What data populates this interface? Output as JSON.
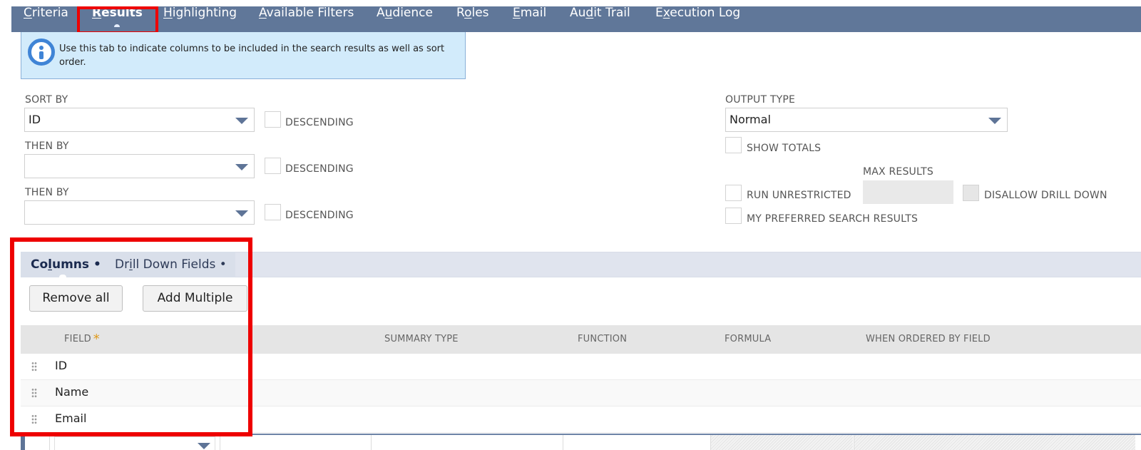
{
  "tabs": [
    {
      "pre": "",
      "u": "C",
      "post": "riteria",
      "active": false
    },
    {
      "pre": "",
      "u": "R",
      "post": "esults",
      "active": true
    },
    {
      "pre": "",
      "u": "H",
      "post": "ighlighting",
      "active": false
    },
    {
      "pre": "",
      "u": "A",
      "post": "vailable Filters",
      "active": false
    },
    {
      "pre": "A",
      "u": "u",
      "post": "dience",
      "active": false
    },
    {
      "pre": "R",
      "u": "o",
      "post": "les",
      "active": false
    },
    {
      "pre": "",
      "u": "E",
      "post": "mail",
      "active": false
    },
    {
      "pre": "Au",
      "u": "d",
      "post": "it Trail",
      "active": false
    },
    {
      "pre": "E",
      "u": "x",
      "post": "ecution Log",
      "active": false
    }
  ],
  "info": {
    "icon": "info-icon",
    "text": "Use this tab to indicate columns to be included in the search results as well as sort order."
  },
  "sorting": {
    "sort_by_label": "SORT BY",
    "sort_by_value": "ID",
    "then_by_label": "THEN BY",
    "then_by_1_value": "",
    "then_by_2_value": "",
    "descending_label": "DESCENDING"
  },
  "output": {
    "output_type_label": "OUTPUT TYPE",
    "output_type_value": "Normal",
    "show_totals_label": "SHOW TOTALS",
    "max_results_label": "MAX RESULTS",
    "max_results_value": "",
    "run_unrestricted_label": "RUN UNRESTRICTED",
    "disallow_drill_down_label": "DISALLOW DRILL DOWN",
    "my_preferred_label": "MY PREFERRED SEARCH RESULTS"
  },
  "subtabs": [
    {
      "pre": "Co",
      "u": "l",
      "post": "umns •",
      "active": true
    },
    {
      "pre": "Dr",
      "u": "i",
      "post": "ll Down Fields •",
      "active": false
    }
  ],
  "buttons": {
    "remove_all": "Remove all",
    "add_multiple": "Add Multiple"
  },
  "table": {
    "columns": [
      "FIELD",
      "SUMMARY TYPE",
      "FUNCTION",
      "FORMULA",
      "WHEN ORDERED BY FIELD"
    ],
    "required_mark": "*",
    "rows": [
      {
        "field": "ID",
        "summary_type": "",
        "function": "",
        "formula": "",
        "when_ordered_by_field": ""
      },
      {
        "field": "Name",
        "summary_type": "",
        "function": "",
        "formula": "",
        "when_ordered_by_field": ""
      },
      {
        "field": "Email",
        "summary_type": "",
        "function": "",
        "formula": "",
        "when_ordered_by_field": ""
      }
    ]
  },
  "colors": {
    "tabbar": "#607799",
    "info_bg": "#d2ebfb",
    "info_icon": "#3f84d6",
    "highlight": "#ee0000",
    "required": "#e09a1b"
  }
}
